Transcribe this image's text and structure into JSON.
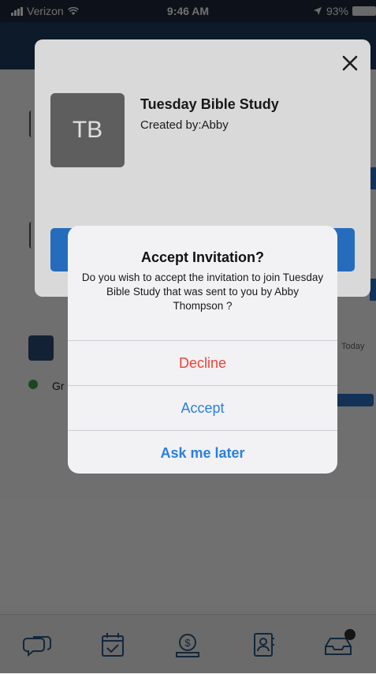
{
  "status_bar": {
    "carrier": "Verizon",
    "time": "9:46 AM",
    "battery": "93%"
  },
  "background": {
    "partial_label": "Gr",
    "today_label": "Today"
  },
  "group_card": {
    "avatar_initials": "TB",
    "name": "Tuesday Bible Study",
    "created_by": "Created by:Abby"
  },
  "alert": {
    "title": "Accept Invitation?",
    "message": "Do you wish to accept the invitation to join Tuesday Bible Study that was sent to you by Abby Thompson ?",
    "decline_label": "Decline",
    "accept_label": "Accept",
    "later_label": "Ask me later"
  },
  "tab_bar": {
    "icons": [
      "chat-icon",
      "calendar-check-icon",
      "donate-icon",
      "contacts-icon",
      "inbox-icon"
    ]
  },
  "colors": {
    "header": "#1c3d61",
    "primary": "#2b7bd6",
    "decline": "#f04137",
    "accept": "#2a7fe0"
  }
}
